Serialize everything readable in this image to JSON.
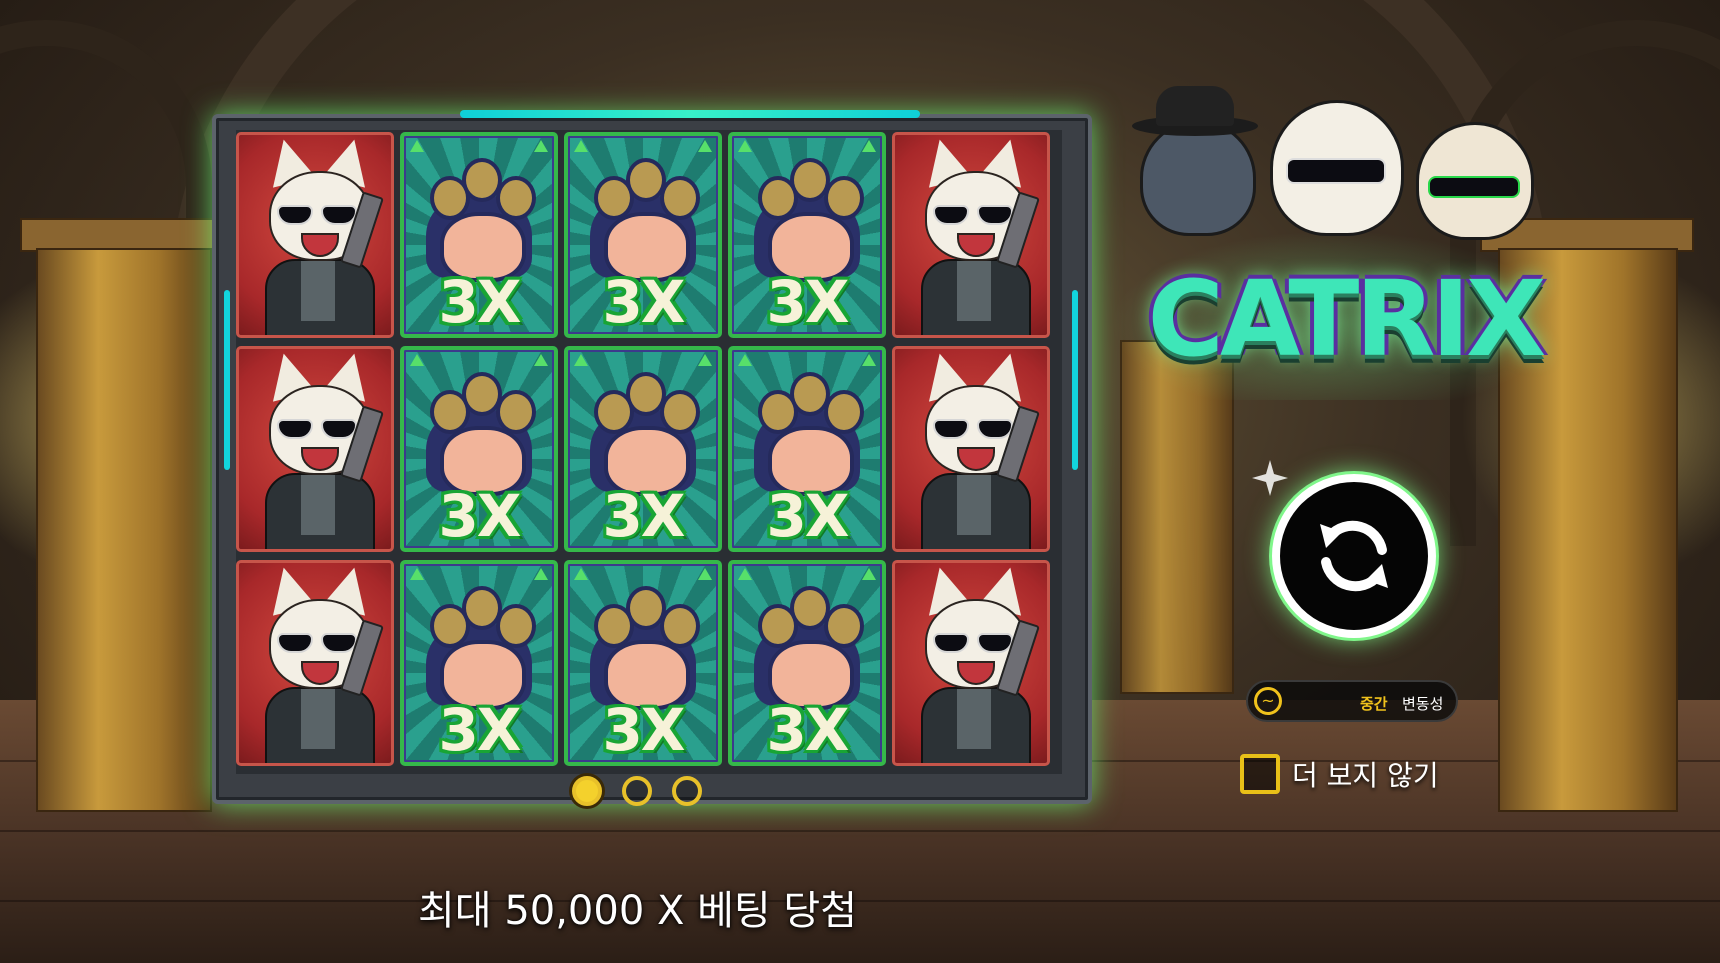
{
  "game": {
    "logo_text": "CATRIX",
    "symbols": {
      "cat_agent": "cat-agent-symbol",
      "paw_multiplier": "3X"
    },
    "grid": [
      [
        "cat",
        "paw",
        "paw",
        "paw",
        "cat"
      ],
      [
        "cat",
        "paw",
        "paw",
        "paw",
        "cat"
      ],
      [
        "cat",
        "paw",
        "paw",
        "paw",
        "cat"
      ]
    ],
    "pagination": {
      "pages": 3,
      "active": 1
    }
  },
  "volatility": {
    "level": "중간",
    "label": "변동성",
    "icon": "volatility-icon"
  },
  "dont_show_again": {
    "label": "더 보지 않기",
    "checked": false
  },
  "caption": "최대 50,000 X 베팅 당첨",
  "spin_button": {
    "icon": "refresh-icon"
  },
  "colors": {
    "frame_glow": "#6eff78",
    "accent_yellow": "#f0c21c",
    "paw_border": "#35b84a",
    "cat_bg": "#a8282a"
  }
}
